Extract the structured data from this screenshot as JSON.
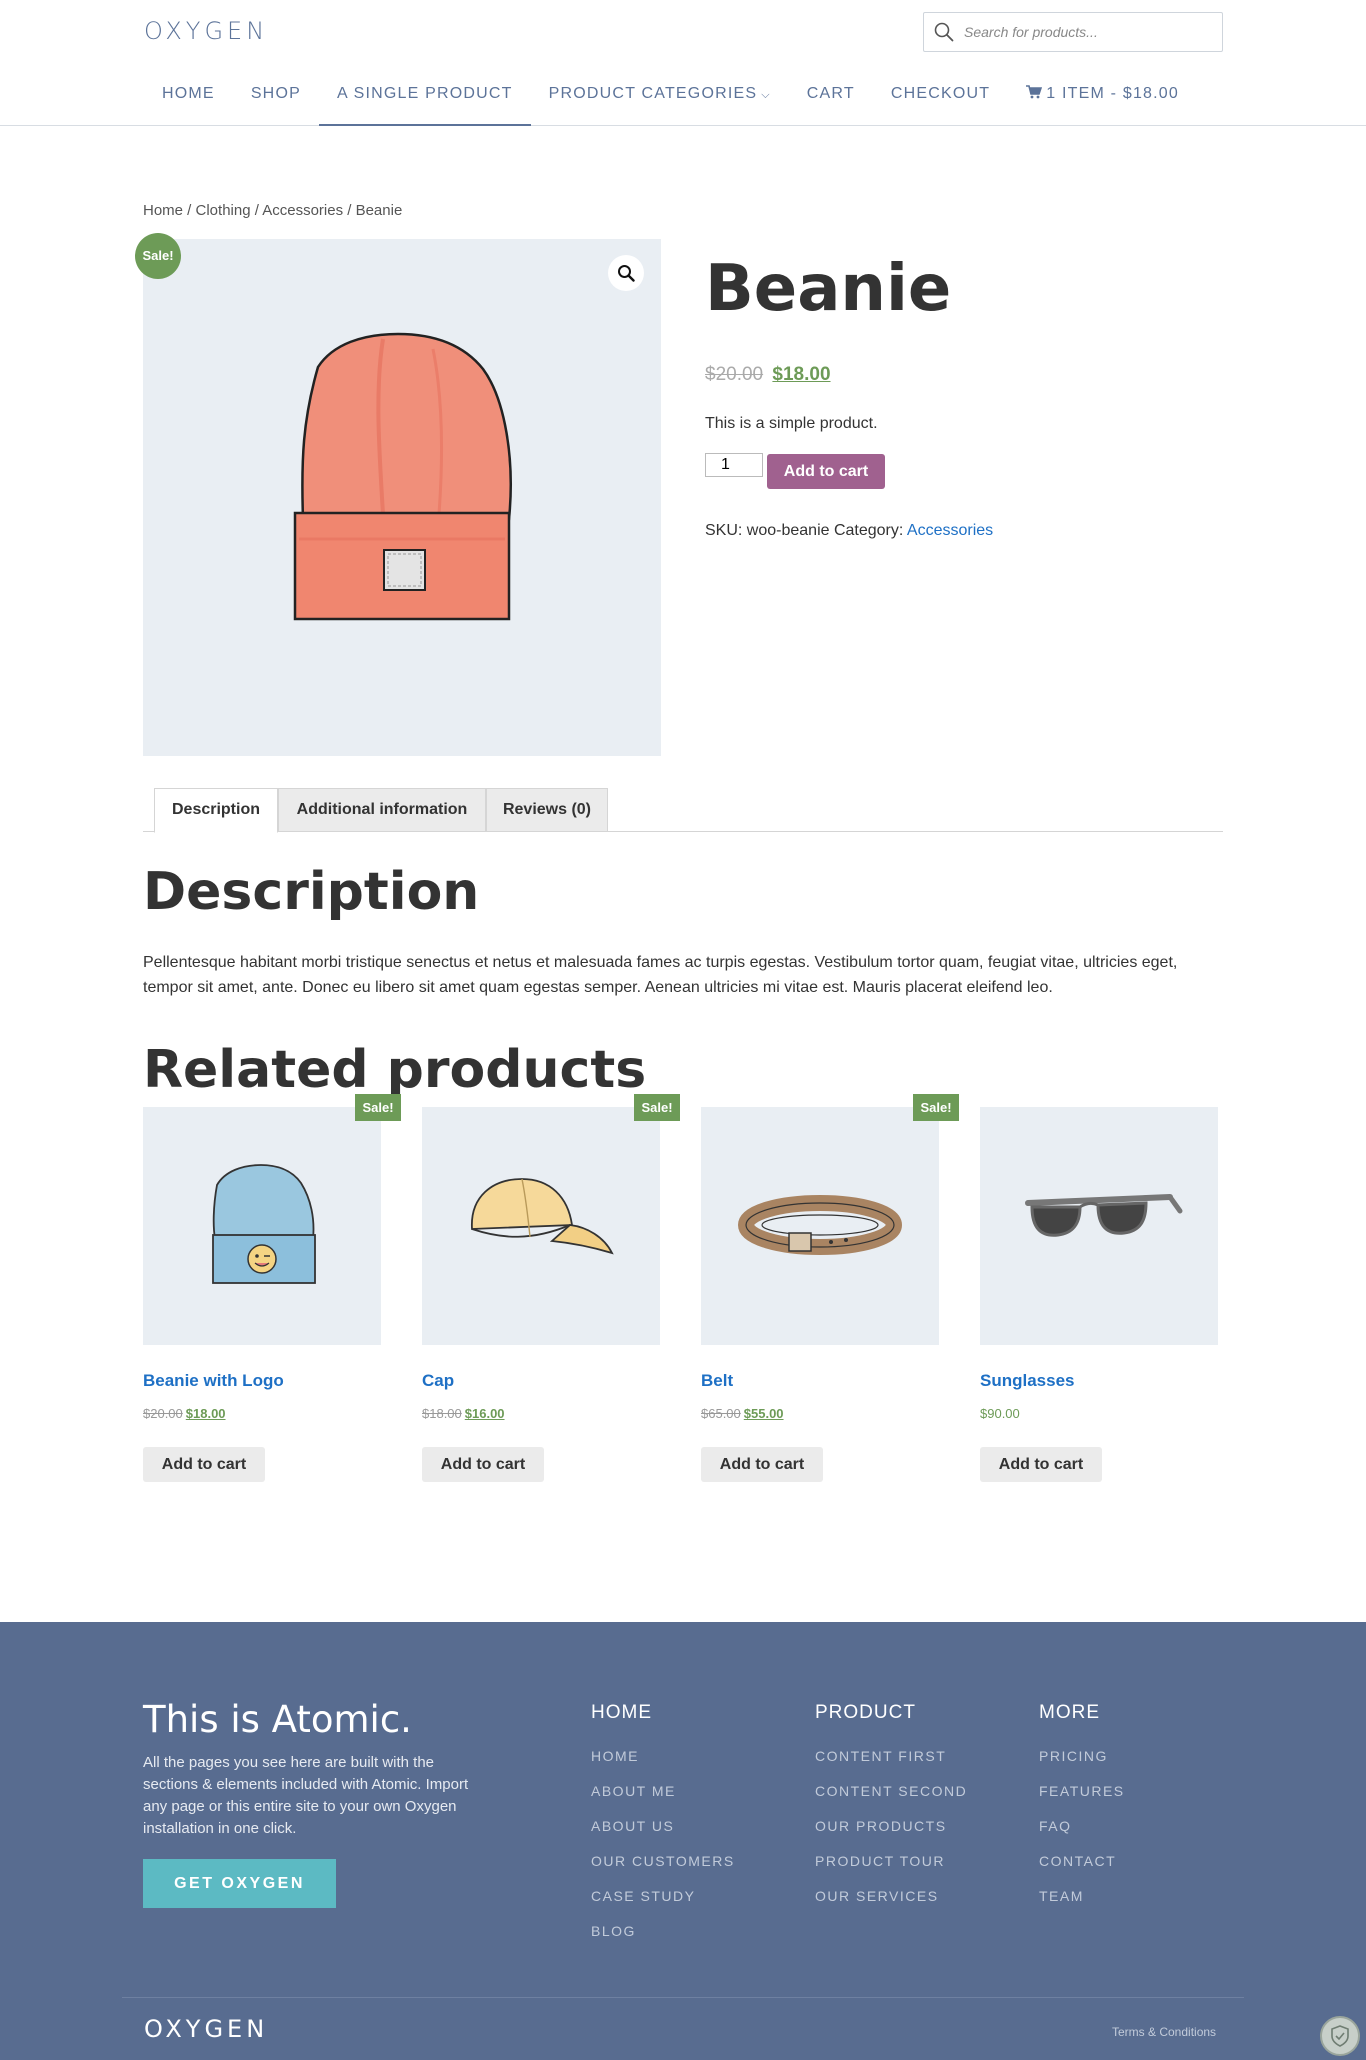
{
  "header": {
    "logo": "OXYGEN",
    "search_placeholder": "Search for products...",
    "nav": [
      {
        "label": "HOME"
      },
      {
        "label": "SHOP"
      },
      {
        "label": "A SINGLE PRODUCT"
      },
      {
        "label": "PRODUCT CATEGORIES"
      },
      {
        "label": "CART"
      },
      {
        "label": "CHECKOUT"
      },
      {
        "label": "1 ITEM - $18.00"
      }
    ]
  },
  "breadcrumb": "Home / Clothing / Accessories / Beanie",
  "product": {
    "sale_badge": "Sale!",
    "title": "Beanie",
    "old_price": "$20.00",
    "new_price": "$18.00",
    "short_description": "This is a simple product.",
    "quantity": "1",
    "add_to_cart": "Add to cart",
    "meta_prefix": "SKU: woo-beanie Category:",
    "category": "Accessories"
  },
  "tabs": [
    {
      "label": "Description"
    },
    {
      "label": "Additional information"
    },
    {
      "label": "Reviews (0)"
    }
  ],
  "description": {
    "heading": "Description",
    "text": "Pellentesque habitant morbi tristique senectus et netus et malesuada fames ac turpis egestas. Vestibulum tortor quam, feugiat vitae, ultricies eget, tempor sit amet, ante. Donec eu libero sit amet quam egestas semper. Aenean ultricies mi vitae est. Mauris placerat eleifend leo."
  },
  "related": {
    "heading": "Related products",
    "items": [
      {
        "name": "Beanie with Logo",
        "old_price": "$20.00",
        "price": "$18.00",
        "sale": "Sale!",
        "button": "Add to cart"
      },
      {
        "name": "Cap",
        "old_price": "$18.00",
        "price": "$16.00",
        "sale": "Sale!",
        "button": "Add to cart"
      },
      {
        "name": "Belt",
        "old_price": "$65.00",
        "price": "$55.00",
        "sale": "Sale!",
        "button": "Add to cart"
      },
      {
        "name": "Sunglasses",
        "old_price": "",
        "price": "$90.00",
        "sale": "",
        "button": "Add to cart"
      }
    ]
  },
  "footer": {
    "title": "This is Atomic.",
    "text": "All the pages you see here are built with the sections & elements included with Atomic. Import any page or this entire site to your own Oxygen installation in one click.",
    "cta": "GET OXYGEN",
    "columns": [
      {
        "heading": "HOME",
        "links": [
          "HOME",
          "ABOUT ME",
          "ABOUT US",
          "OUR CUSTOMERS",
          "CASE STUDY",
          "BLOG"
        ]
      },
      {
        "heading": "PRODUCT",
        "links": [
          "CONTENT FIRST",
          "CONTENT SECOND",
          "OUR PRODUCTS",
          "PRODUCT TOUR",
          "OUR SERVICES"
        ]
      },
      {
        "heading": "MORE",
        "links": [
          "PRICING",
          "FEATURES",
          "FAQ",
          "CONTACT",
          "TEAM"
        ]
      }
    ],
    "logo": "OXYGEN",
    "terms": "Terms & Conditions"
  },
  "colors": {
    "brand": "#5c7399",
    "sale_green": "#6d9b57",
    "link_blue": "#1e70c5",
    "cart_button": "#a0618f",
    "footer_bg": "#586c90",
    "cta_teal": "#5cbac3"
  }
}
